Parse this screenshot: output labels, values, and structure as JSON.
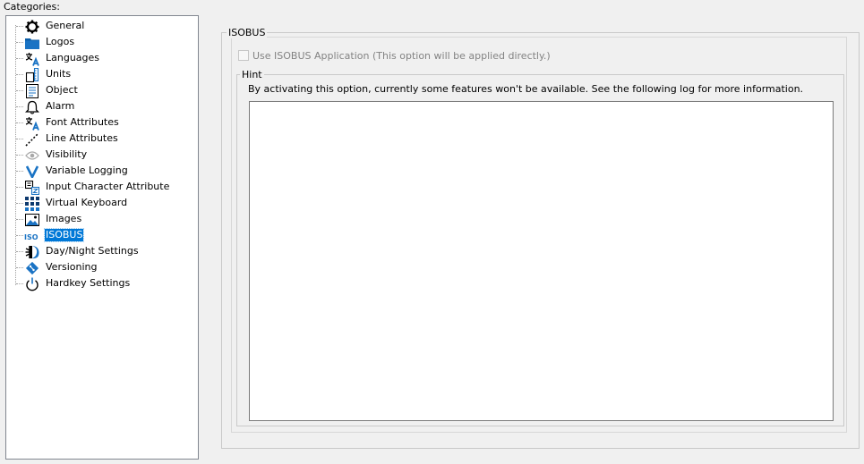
{
  "categories_label": "Categories:",
  "tree": {
    "items": [
      {
        "label": "General",
        "icon": "gear-icon"
      },
      {
        "label": "Logos",
        "icon": "folder-icon"
      },
      {
        "label": "Languages",
        "icon": "language-icon"
      },
      {
        "label": "Units",
        "icon": "units-icon"
      },
      {
        "label": "Object",
        "icon": "object-icon"
      },
      {
        "label": "Alarm",
        "icon": "bell-icon"
      },
      {
        "label": "Font Attributes",
        "icon": "font-icon"
      },
      {
        "label": "Line Attributes",
        "icon": "line-icon"
      },
      {
        "label": "Visibility",
        "icon": "eye-icon"
      },
      {
        "label": "Variable Logging",
        "icon": "variable-logging-icon"
      },
      {
        "label": "Input Character Attribute",
        "icon": "input-character-icon"
      },
      {
        "label": "Virtual Keyboard",
        "icon": "keyboard-icon"
      },
      {
        "label": "Images",
        "icon": "image-icon"
      },
      {
        "label": "ISOBUS",
        "icon": "iso-icon",
        "selected": true
      },
      {
        "label": "Day/Night Settings",
        "icon": "day-night-icon"
      },
      {
        "label": "Versioning",
        "icon": "versioning-icon"
      },
      {
        "label": "Hardkey Settings",
        "icon": "power-icon"
      }
    ]
  },
  "panel": {
    "group_title": "ISOBUS",
    "checkbox_label": "Use ISOBUS Application (This option will be applied directly.)",
    "checkbox_checked": false,
    "checkbox_enabled": false,
    "hint_title": "Hint",
    "hint_text": "By activating this option, currently some features won't be available. See the following  log for more information.",
    "log_text": ""
  },
  "colors": {
    "selection": "#0078d7",
    "icon_blue": "#1a73c4",
    "background": "#f0f0f0"
  }
}
